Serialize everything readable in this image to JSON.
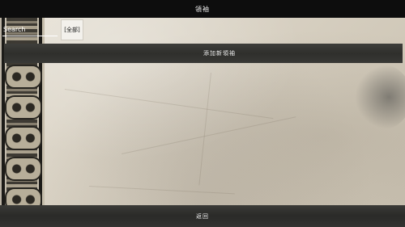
{
  "header": {
    "title": "領袖"
  },
  "search": {
    "label": "Search",
    "filter_label": "[全部]"
  },
  "actions": {
    "add_new_label": "添加新領袖",
    "return_label": "返回"
  },
  "colors": {
    "bar_dark": "#0d0d0d",
    "banner": "#333331",
    "paper": "#d9d2c4"
  }
}
